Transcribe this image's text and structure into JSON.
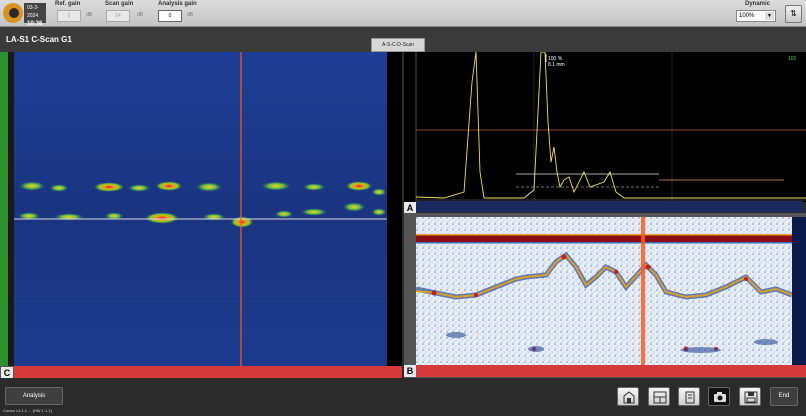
{
  "toolbar": {
    "date": "03-3-2024",
    "time": "10:36",
    "ref_gain_label": "Ref. gain",
    "ref_gain_value": "0",
    "scan_gain_label": "Scan gain",
    "scan_gain_value": "14",
    "analysis_gain_label": "Analysis gain",
    "analysis_gain_value": "0",
    "db_unit": "dB",
    "dynamic_label": "Dynamic",
    "dynamic_value": "100%"
  },
  "view": {
    "title": "LA-S1 C-Scan G1",
    "tab_label": "A-S-C-D-Scan",
    "c_label": "C",
    "a_label": "A",
    "b_label": "B",
    "ascan_cursor_line1": "100 %",
    "ascan_cursor_line2": "8.1 mm",
    "ascan_corner": "100"
  },
  "bottom": {
    "analysis_label": "Analysis",
    "end_label": "End",
    "version_text": "Cursor v1.1.1  ...  (HW 1.1.1)"
  },
  "icons": [
    "logo-icon",
    "dynamic-settings-icon",
    "report-icon",
    "layout-icon",
    "clipboard-icon",
    "camera-icon",
    "save-icon"
  ],
  "colors": {
    "accent_orange": "#ff5a1a",
    "cscan_bg": "#1f3c8e",
    "ascan_signal": "#f0e060",
    "gate": "#d4a040"
  }
}
